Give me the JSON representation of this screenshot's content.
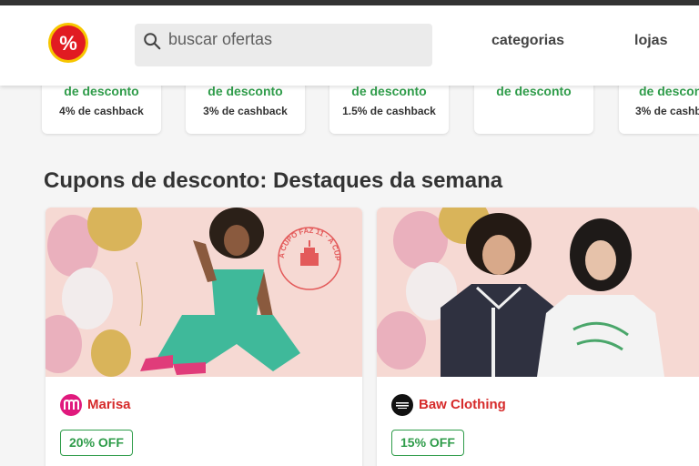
{
  "header": {
    "search_placeholder": "buscar ofertas",
    "nav": [
      {
        "label": "categorias"
      },
      {
        "label": "lojas"
      }
    ]
  },
  "mini_cards": [
    {
      "discount_text": "de desconto",
      "cashback": "4% de cashback"
    },
    {
      "discount_text": "de desconto",
      "cashback": "3% de cashback"
    },
    {
      "discount_text": "de desconto",
      "cashback": "1.5% de cashback"
    },
    {
      "discount_text": "de desconto",
      "cashback": ""
    },
    {
      "discount_text": "de descon",
      "cashback": "3% de cashb"
    }
  ],
  "section": {
    "title": "Cupons de desconto: Destaques da semana"
  },
  "deals": [
    {
      "store": "Marisa",
      "badge": "20% OFF",
      "stamp_text": "A CUPO FAZ 11 · A CUPO FAZ 11"
    },
    {
      "store": "Baw Clothing",
      "badge": "15% OFF",
      "logo_text": "BAW CLOTHING"
    }
  ],
  "colors": {
    "brand_red": "#e11b22",
    "green": "#2f9c4a",
    "store_red": "#d62a2a",
    "marisa_pink": "#e0197d"
  }
}
